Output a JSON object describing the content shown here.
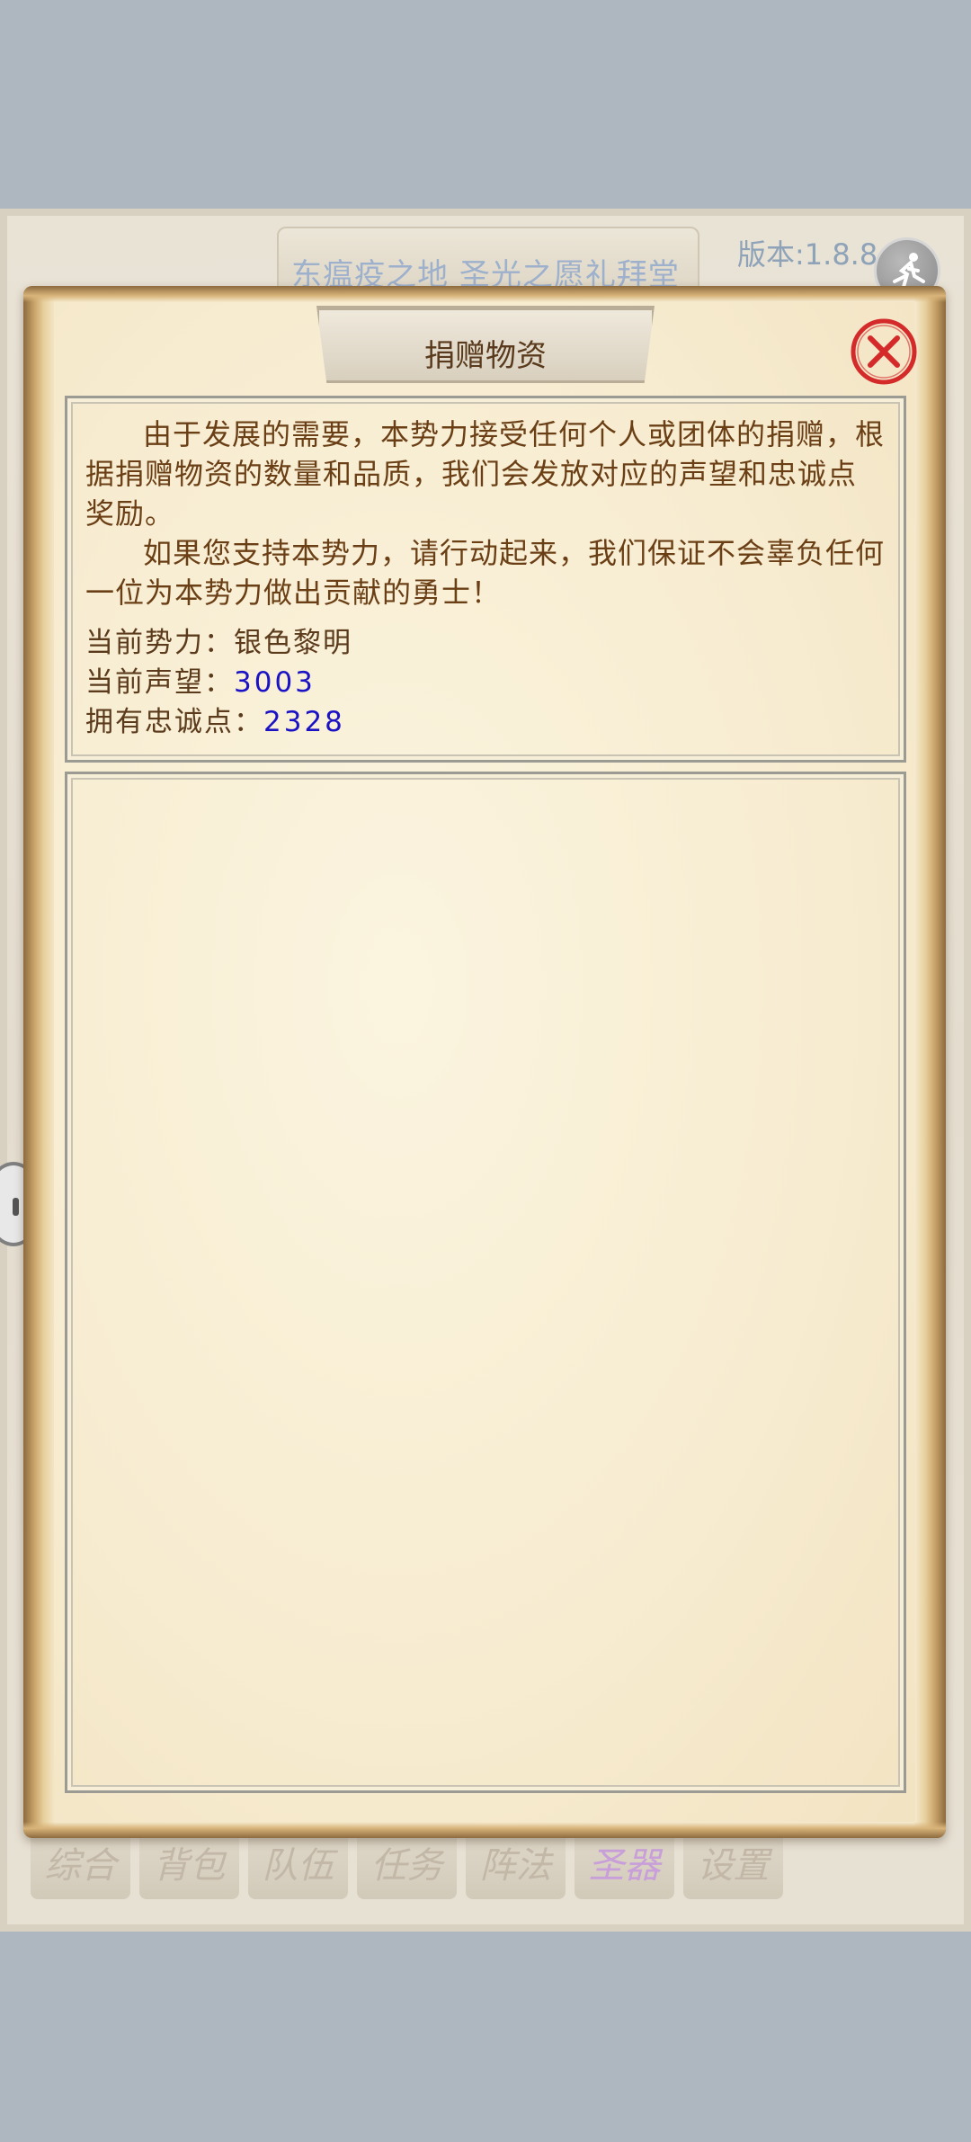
{
  "header": {
    "location": "东瘟疫之地  圣光之愿礼拜堂",
    "version": "版本:1.8.8",
    "exit_icon": "running-man-exit-icon"
  },
  "dialog": {
    "title": "捐赠物资",
    "close_icon": "close-x-icon",
    "paragraph1": "由于发展的需要，本势力接受任何个人或团体的捐赠，根据捐赠物资的数量和品质，我们会发放对应的声望和忠诚点奖励。",
    "paragraph2": "如果您支持本势力，请行动起来，我们保证不会辜负任何一位为本势力做出贡献的勇士！",
    "faction_label": "当前势力：",
    "faction_value": "银色黎明",
    "reputation_label": "当前声望：",
    "reputation_value": "3003",
    "loyalty_label": "拥有忠诚点：",
    "loyalty_value": "2328"
  },
  "tabs": [
    {
      "label": "综合"
    },
    {
      "label": "背包"
    },
    {
      "label": "队伍"
    },
    {
      "label": "任务"
    },
    {
      "label": "阵法"
    },
    {
      "label": "圣器",
      "active": true
    },
    {
      "label": "设置"
    }
  ],
  "colors": {
    "value_blue": "#1a12c4",
    "text_brown": "#6b3f16",
    "close_red": "#d42a2a",
    "active_tab": "#c89fd9"
  }
}
